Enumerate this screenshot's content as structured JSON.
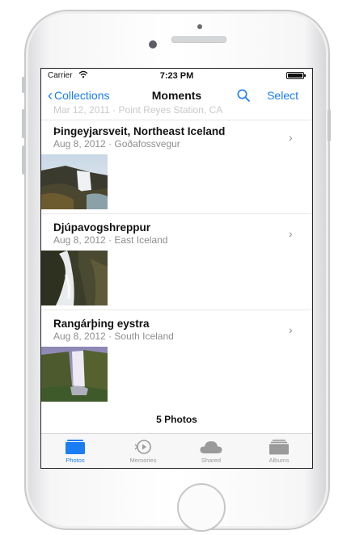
{
  "statusbar": {
    "carrier": "Carrier",
    "time": "7:23 PM"
  },
  "navbar": {
    "back_label": "Collections",
    "title": "Moments",
    "select_label": "Select"
  },
  "ghost_row": {
    "date": "Mar 12, 2011",
    "place": "Point Reyes Station, CA"
  },
  "moments": [
    {
      "title": "Þingeyjarsveit, Northeast Iceland",
      "date": "Aug 8, 2012",
      "place": "Goðafossvegur"
    },
    {
      "title": "Djúpavogshreppur",
      "date": "Aug 8, 2012",
      "place": "East Iceland"
    },
    {
      "title": "Rangárþing eystra",
      "date": "Aug 8, 2012",
      "place": "South Iceland"
    }
  ],
  "separator": "·",
  "photo_count": "5 Photos",
  "tabs": [
    {
      "label": "Photos",
      "icon": "photos-icon",
      "active": true
    },
    {
      "label": "Memories",
      "icon": "memories-icon",
      "active": false
    },
    {
      "label": "Shared",
      "icon": "cloud-icon",
      "active": false
    },
    {
      "label": "Albums",
      "icon": "albums-icon",
      "active": false
    }
  ],
  "colors": {
    "accent": "#1a7df4",
    "secondary_text": "#8e8e93"
  }
}
